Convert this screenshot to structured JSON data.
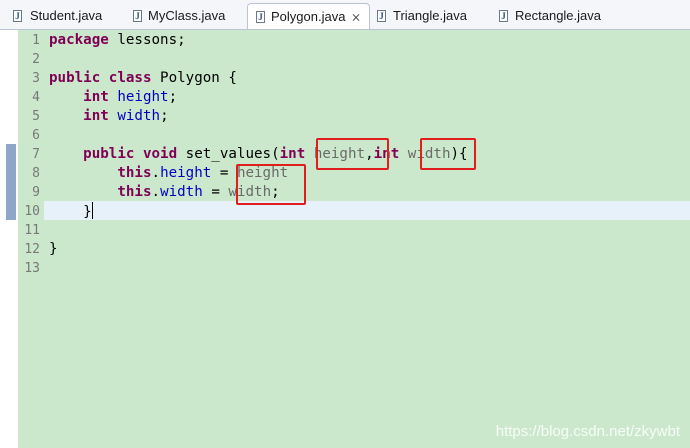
{
  "tabs": [
    {
      "label": "Student.java",
      "icon": "java-file-icon",
      "active": false
    },
    {
      "label": "MyClass.java",
      "icon": "java-file-icon",
      "active": false
    },
    {
      "label": "Polygon.java",
      "icon": "java-file-icon",
      "active": true,
      "close_glyph": "⨯"
    },
    {
      "label": "Triangle.java",
      "icon": "java-file-icon",
      "active": false
    },
    {
      "label": "Rectangle.java",
      "icon": "java-file-icon",
      "active": false
    }
  ],
  "editor": {
    "line_numbers": [
      "1",
      "2",
      "3",
      "4",
      "5",
      "6",
      "7",
      "8",
      "9",
      "10",
      "11",
      "12",
      "13"
    ],
    "lines": [
      [
        {
          "t": "package",
          "c": "kw"
        },
        {
          "t": " lessons;",
          "c": ""
        }
      ],
      [],
      [
        {
          "t": "public",
          "c": "kw"
        },
        {
          "t": " ",
          "c": ""
        },
        {
          "t": "class",
          "c": "kw"
        },
        {
          "t": " Polygon {",
          "c": ""
        }
      ],
      [
        {
          "t": "    ",
          "c": ""
        },
        {
          "t": "int",
          "c": "kw"
        },
        {
          "t": " ",
          "c": ""
        },
        {
          "t": "height",
          "c": "fld"
        },
        {
          "t": ";",
          "c": ""
        }
      ],
      [
        {
          "t": "    ",
          "c": ""
        },
        {
          "t": "int",
          "c": "kw"
        },
        {
          "t": " ",
          "c": ""
        },
        {
          "t": "width",
          "c": "fld"
        },
        {
          "t": ";",
          "c": ""
        }
      ],
      [],
      [
        {
          "t": "    ",
          "c": ""
        },
        {
          "t": "public",
          "c": "kw"
        },
        {
          "t": " ",
          "c": ""
        },
        {
          "t": "void",
          "c": "kw"
        },
        {
          "t": " set_values(",
          "c": ""
        },
        {
          "t": "int",
          "c": "kw"
        },
        {
          "t": " ",
          "c": ""
        },
        {
          "t": "height",
          "c": "prm"
        },
        {
          "t": ",",
          "c": ""
        },
        {
          "t": "int",
          "c": "kw"
        },
        {
          "t": " ",
          "c": ""
        },
        {
          "t": "width",
          "c": "prm"
        },
        {
          "t": "){",
          "c": ""
        }
      ],
      [
        {
          "t": "        ",
          "c": ""
        },
        {
          "t": "this",
          "c": "kw"
        },
        {
          "t": ".",
          "c": ""
        },
        {
          "t": "height",
          "c": "fld"
        },
        {
          "t": " = ",
          "c": ""
        },
        {
          "t": "height",
          "c": "prm"
        }
      ],
      [
        {
          "t": "        ",
          "c": ""
        },
        {
          "t": "this",
          "c": "kw"
        },
        {
          "t": ".",
          "c": ""
        },
        {
          "t": "width",
          "c": "fld"
        },
        {
          "t": " = ",
          "c": ""
        },
        {
          "t": "width",
          "c": "prm"
        },
        {
          "t": ";",
          "c": ""
        }
      ],
      [
        {
          "t": "    }",
          "c": ""
        }
      ],
      [],
      [
        {
          "t": "}",
          "c": ""
        }
      ],
      []
    ],
    "cursor_line": 10,
    "colors": {
      "background": "#cbe8cc",
      "keyword": "#7f0055",
      "field": "#0000c0",
      "parameter": "#6a6a6a",
      "highlight_box": "#e21d1d"
    }
  },
  "watermark": "https://blog.csdn.net/zkywbt"
}
